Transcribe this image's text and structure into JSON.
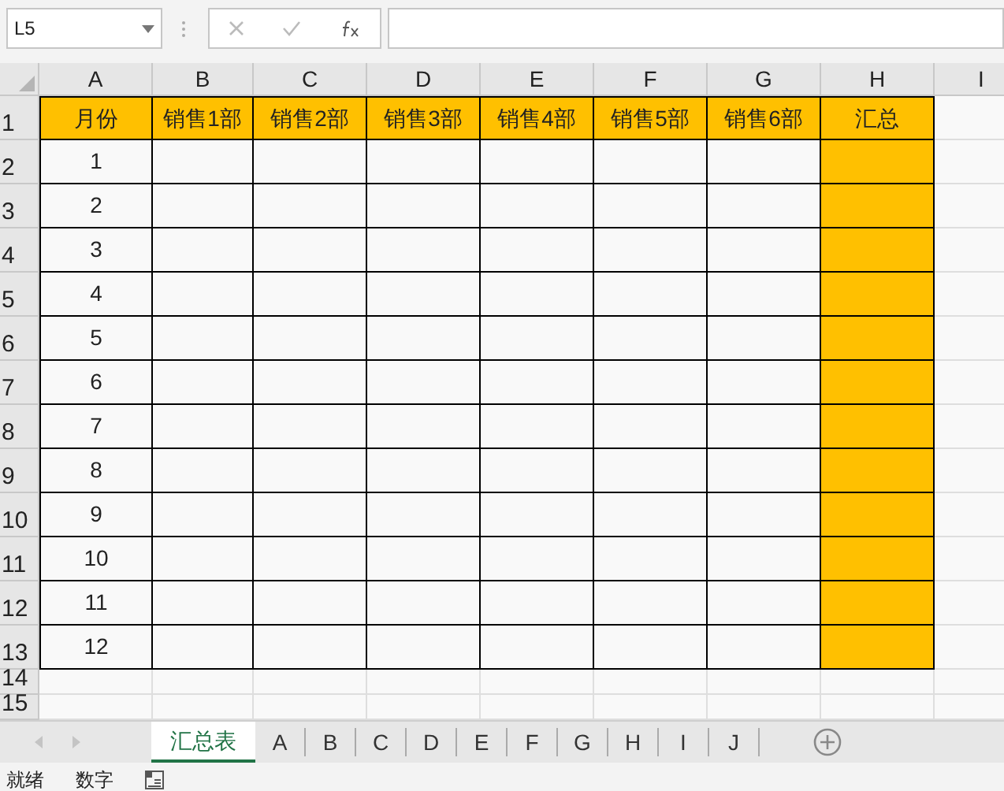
{
  "name_box": {
    "value": "L5"
  },
  "columns": [
    {
      "letter": "A",
      "highlighted": false
    },
    {
      "letter": "B",
      "highlighted": false
    },
    {
      "letter": "C",
      "highlighted": false
    },
    {
      "letter": "D",
      "highlighted": false
    },
    {
      "letter": "E",
      "highlighted": false
    },
    {
      "letter": "F",
      "highlighted": false
    },
    {
      "letter": "G",
      "highlighted": false
    },
    {
      "letter": "H",
      "highlighted": true
    },
    {
      "letter": "I",
      "highlighted": false
    }
  ],
  "header_row": {
    "number": "1",
    "cells": [
      "月份",
      "销售1部",
      "销售2部",
      "销售3部",
      "销售4部",
      "销售5部",
      "销售6部",
      "汇总"
    ]
  },
  "rows": [
    {
      "number": "2",
      "month": "1"
    },
    {
      "number": "3",
      "month": "2"
    },
    {
      "number": "4",
      "month": "3"
    },
    {
      "number": "5",
      "month": "4"
    },
    {
      "number": "6",
      "month": "5"
    },
    {
      "number": "7",
      "month": "6"
    },
    {
      "number": "8",
      "month": "7"
    },
    {
      "number": "9",
      "month": "8"
    },
    {
      "number": "10",
      "month": "9"
    },
    {
      "number": "11",
      "month": "10"
    },
    {
      "number": "12",
      "month": "11"
    },
    {
      "number": "13",
      "month": "12"
    }
  ],
  "empty_rows": [
    "14",
    "15"
  ],
  "sheet_tabs": [
    {
      "label": "汇总表",
      "selected": true
    },
    {
      "label": "A",
      "selected": false
    },
    {
      "label": "B",
      "selected": false
    },
    {
      "label": "C",
      "selected": false
    },
    {
      "label": "D",
      "selected": false
    },
    {
      "label": "E",
      "selected": false
    },
    {
      "label": "F",
      "selected": false
    },
    {
      "label": "G",
      "selected": false
    },
    {
      "label": "H",
      "selected": false
    },
    {
      "label": "I",
      "selected": false
    },
    {
      "label": "J",
      "selected": false
    }
  ],
  "status_bar": [
    "就绪",
    "数字"
  ]
}
